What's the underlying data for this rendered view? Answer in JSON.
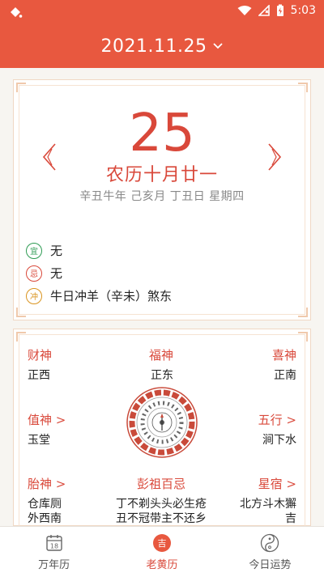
{
  "status_bar": {
    "time": "5:03"
  },
  "header": {
    "date": "2021.11.25"
  },
  "day_card": {
    "day_number": "25",
    "lunar_date": "农历十月廿一",
    "ganzhi_line": "辛丑牛年 己亥月 丁丑日 星期四",
    "yi_badge": "宜",
    "yi_text": "无",
    "ji_badge": "忌",
    "ji_text": "无",
    "chong_badge": "冲",
    "chong_text": "牛日冲羊（辛未）煞东"
  },
  "gods": {
    "cai_shen": {
      "title": "财神",
      "value": "正西"
    },
    "fu_shen": {
      "title": "福神",
      "value": "正东"
    },
    "xi_shen": {
      "title": "喜神",
      "value": "正南"
    },
    "zhi_shen": {
      "title": "值神 >",
      "value": "玉堂"
    },
    "wu_xing": {
      "title": "五行 >",
      "value": "涧下水"
    },
    "tai_shen": {
      "title": "胎神 >",
      "value_line1": "仓库厕",
      "value_line2": "外西南"
    },
    "peng_zu": {
      "title": "彭祖百忌",
      "value_line1": "丁不剃头头必生疮",
      "value_line2": "丑不冠带主不还乡"
    },
    "xing_xiu": {
      "title": "星宿 >",
      "value_line1": "北方斗木獬",
      "value_line2": "吉"
    }
  },
  "tabs": [
    {
      "label": "万年历",
      "icon": "calendar-icon",
      "icon_text": "18"
    },
    {
      "label": "老黄历",
      "icon": "almanac-icon",
      "icon_text": "吉",
      "active": true
    },
    {
      "label": "今日运势",
      "icon": "yinyang-icon"
    }
  ],
  "colors": {
    "accent": "#e8583f",
    "title_red": "#d9483a",
    "yi_green": "#2e9b53",
    "ji_red": "#d9483a",
    "chong_orange": "#d9941f"
  }
}
